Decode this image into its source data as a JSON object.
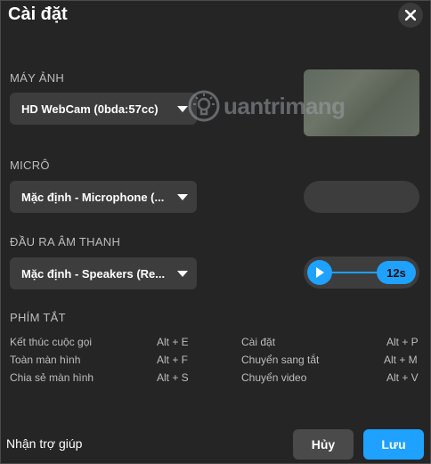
{
  "dialog": {
    "title": "Cài đặt"
  },
  "camera": {
    "label": "MÁY ẢNH",
    "device": "HD WebCam (0bda:57cc)"
  },
  "mic": {
    "label": "MICRÔ",
    "device": "Mặc định - Microphone (..."
  },
  "speaker": {
    "label": "ĐẦU RA ÂM THANH",
    "device": "Mặc định - Speakers (Re...",
    "test_time": "12s"
  },
  "shortcuts": {
    "label": "PHÍM TẮT",
    "left": [
      {
        "action": "Kết thúc cuộc gọi",
        "key": "Alt + E"
      },
      {
        "action": "Toàn màn hình",
        "key": "Alt + F"
      },
      {
        "action": "Chia sẻ màn hình",
        "key": "Alt + S"
      }
    ],
    "right": [
      {
        "action": "Cài đặt",
        "key": "Alt + P"
      },
      {
        "action": "Chuyển sang tắt",
        "key": "Alt + M"
      },
      {
        "action": "Chuyển video",
        "key": "Alt + V"
      }
    ]
  },
  "footer": {
    "help": "Nhận trợ giúp",
    "cancel": "Hủy",
    "save": "Lưu"
  },
  "watermark": {
    "text": "uantrimang"
  },
  "colors": {
    "accent": "#1ea1ff",
    "background": "#252525",
    "control": "#3d3d3d"
  },
  "icons": {
    "close": "close-icon",
    "chevron": "chevron-down-icon",
    "play": "play-icon",
    "bulb": "lightbulb-icon"
  }
}
